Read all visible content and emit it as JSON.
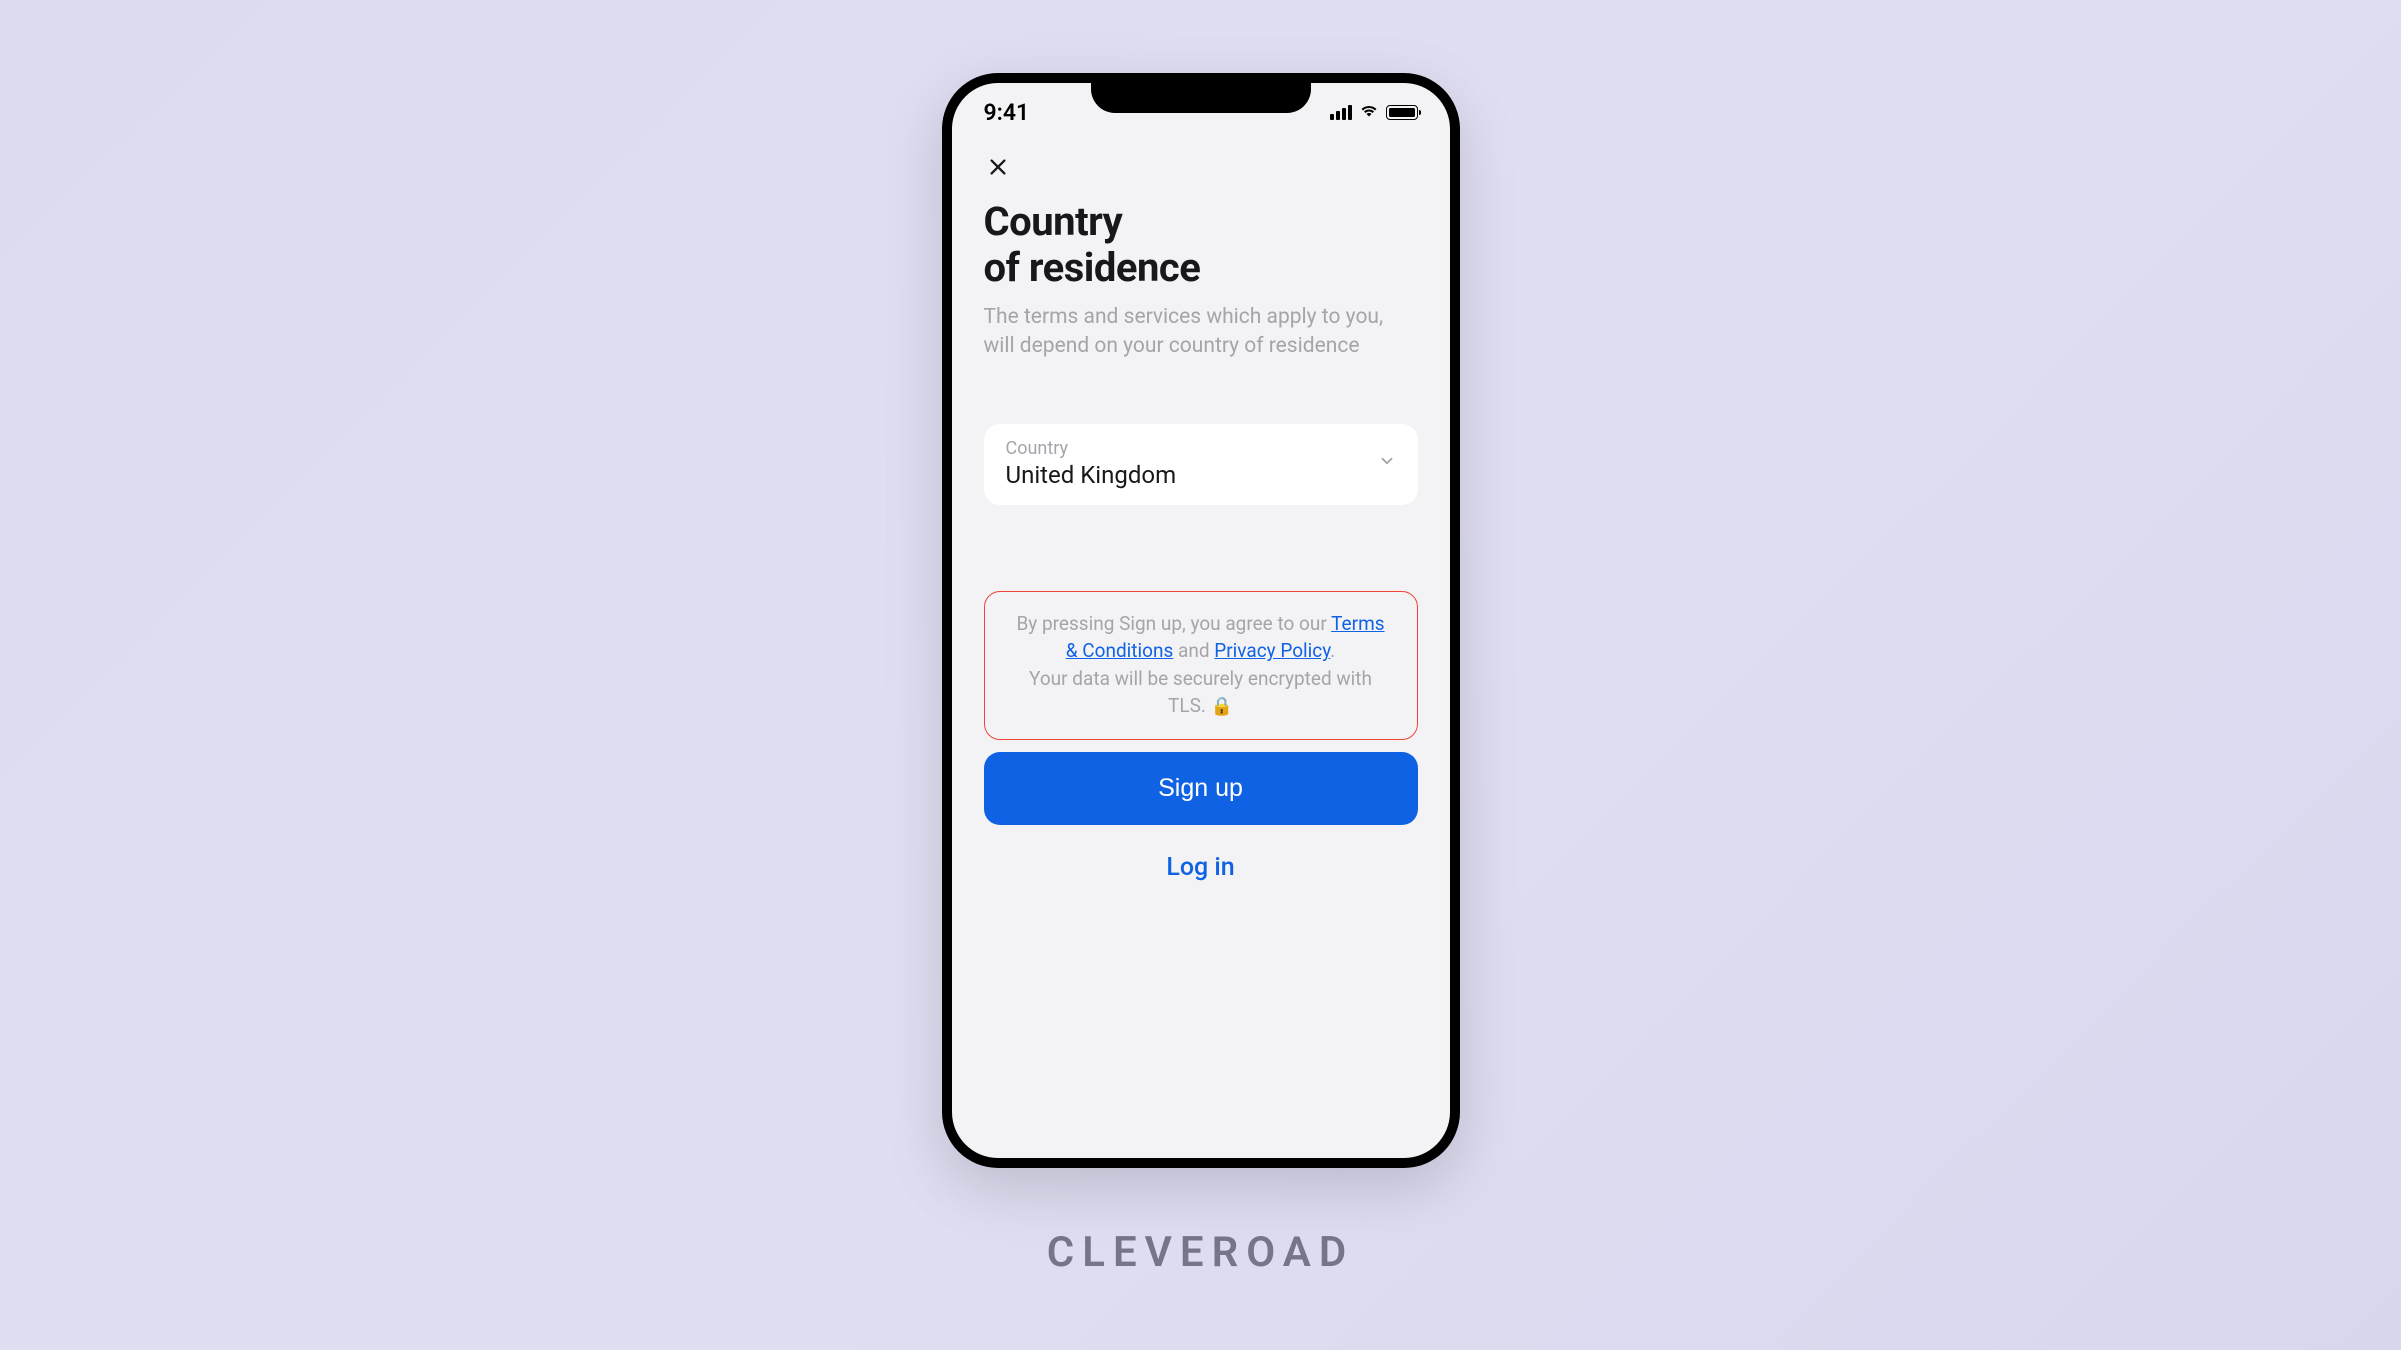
{
  "statusBar": {
    "time": "9:41"
  },
  "page": {
    "titleLine1": "Country",
    "titleLine2": "of residence",
    "subtitle": "The terms and services which apply to you, will depend on your country of residence"
  },
  "countrySelect": {
    "label": "Country",
    "value": "United Kingdom"
  },
  "terms": {
    "prefix": "By pressing Sign up, you agree to our ",
    "termsLink": "Terms & Conditions",
    "connector": " and ",
    "privacyLink": "Privacy Policy",
    "period": ".",
    "encryption": "Your data will be securely encrypted with TLS. ",
    "lockEmoji": "🔒"
  },
  "buttons": {
    "signup": "Sign up",
    "login": "Log in"
  },
  "brand": {
    "name": "CLEVEROAD"
  }
}
